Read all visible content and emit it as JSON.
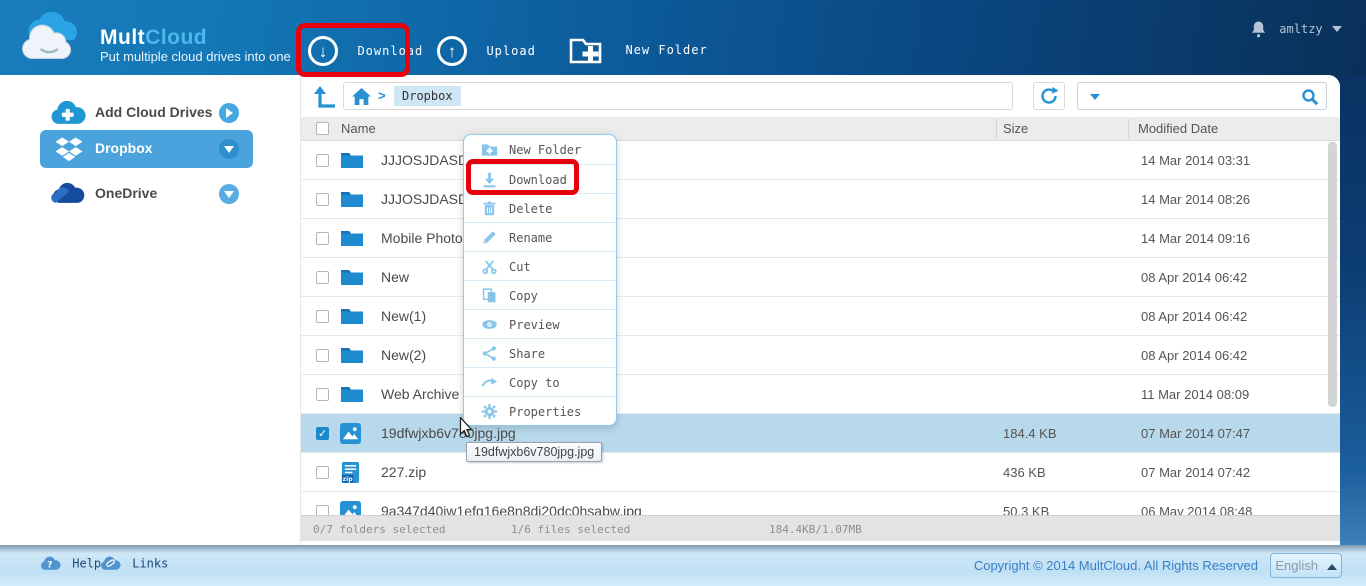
{
  "header": {
    "brand": {
      "part1": "Mult",
      "part2": "Cloud",
      "tagline": "Put multiple cloud drives into one"
    },
    "toolbar": [
      {
        "label": "Download",
        "icon": "download-circle-icon",
        "highlighted": true
      },
      {
        "label": "Upload",
        "icon": "upload-circle-icon"
      },
      {
        "label": "New Folder",
        "icon": "new-folder-icon"
      }
    ],
    "user": {
      "name": "amltzy"
    }
  },
  "sidebar": {
    "items": [
      {
        "label": "Add Cloud Drives",
        "icon": "add-cloud-icon",
        "chevron": "right",
        "selected": false
      },
      {
        "label": "Dropbox",
        "icon": "dropbox-icon",
        "chevron": "down",
        "selected": true
      },
      {
        "label": "OneDrive",
        "icon": "onedrive-icon",
        "chevron": "down",
        "selected": false
      }
    ]
  },
  "main": {
    "breadcrumb": {
      "current": "Dropbox"
    },
    "search": {
      "value": "",
      "placeholder": ""
    },
    "table": {
      "headers": {
        "name": "Name",
        "size": "Size",
        "modified": "Modified Date"
      },
      "rows": [
        {
          "name": "JJJOSJDASDJAC",
          "type": "folder",
          "size": "",
          "modified": "14 Mar 2014 03:31",
          "checked": false,
          "selected": false
        },
        {
          "name": "JJJOSJDASDJAC",
          "type": "folder",
          "size": "",
          "modified": "14 Mar 2014 08:26",
          "checked": false,
          "selected": false
        },
        {
          "name": "Mobile Photos",
          "type": "folder",
          "size": "",
          "modified": "14 Mar 2014 09:16",
          "checked": false,
          "selected": false
        },
        {
          "name": "New",
          "type": "folder",
          "size": "",
          "modified": "08 Apr 2014 06:42",
          "checked": false,
          "selected": false
        },
        {
          "name": "New(1)",
          "type": "folder",
          "size": "",
          "modified": "08 Apr 2014 06:42",
          "checked": false,
          "selected": false
        },
        {
          "name": "New(2)",
          "type": "folder",
          "size": "",
          "modified": "08 Apr 2014 06:42",
          "checked": false,
          "selected": false
        },
        {
          "name": "Web Archive",
          "type": "folder",
          "size": "",
          "modified": "11 Mar 2014 08:09",
          "checked": false,
          "selected": false
        },
        {
          "name": "19dfwjxb6v780jpg.jpg",
          "type": "image",
          "size": "184.4 KB",
          "modified": "07 Mar 2014 07:47",
          "checked": true,
          "selected": true
        },
        {
          "name": "227.zip",
          "type": "zip",
          "size": "436 KB",
          "modified": "07 Mar 2014 07:42",
          "checked": false,
          "selected": false
        },
        {
          "name": "9a347d40jw1efg16e8n8di20dc0hsabw.jpg",
          "type": "image",
          "size": "50.3 KB",
          "modified": "06 May 2014 08:48",
          "checked": false,
          "selected": false
        }
      ]
    },
    "status_bar": {
      "folders": "0/7 folders selected",
      "files": "1/6 files selected",
      "size": "184.4KB/1.07MB"
    }
  },
  "context_menu": {
    "items": [
      {
        "label": "New Folder",
        "icon": "new-folder-icon"
      },
      {
        "label": "Download",
        "icon": "download-icon",
        "highlighted": true
      },
      {
        "label": "Delete",
        "icon": "trash-icon"
      },
      {
        "label": "Rename",
        "icon": "pencil-icon"
      },
      {
        "label": "Cut",
        "icon": "scissors-icon"
      },
      {
        "label": "Copy",
        "icon": "copy-icon"
      },
      {
        "label": "Preview",
        "icon": "eye-icon"
      },
      {
        "label": "Share",
        "icon": "share-icon"
      },
      {
        "label": "Copy to",
        "icon": "copy-to-icon"
      },
      {
        "label": "Properties",
        "icon": "gear-icon"
      }
    ]
  },
  "tooltip": {
    "text": "19dfwjxb6v780jpg.jpg"
  },
  "footer": {
    "help": "Help",
    "links": "Links",
    "copyright": "Copyright © 2014 MultCloud. All Rights Reserved",
    "language": "English"
  },
  "colors": {
    "accent_blue": "#2692d4",
    "selected_row": "#b7d9eb",
    "sidebar_selected": "#4aa3dd",
    "highlight_red": "#e8000c",
    "menu_icon_blue": "#86c5ea"
  }
}
